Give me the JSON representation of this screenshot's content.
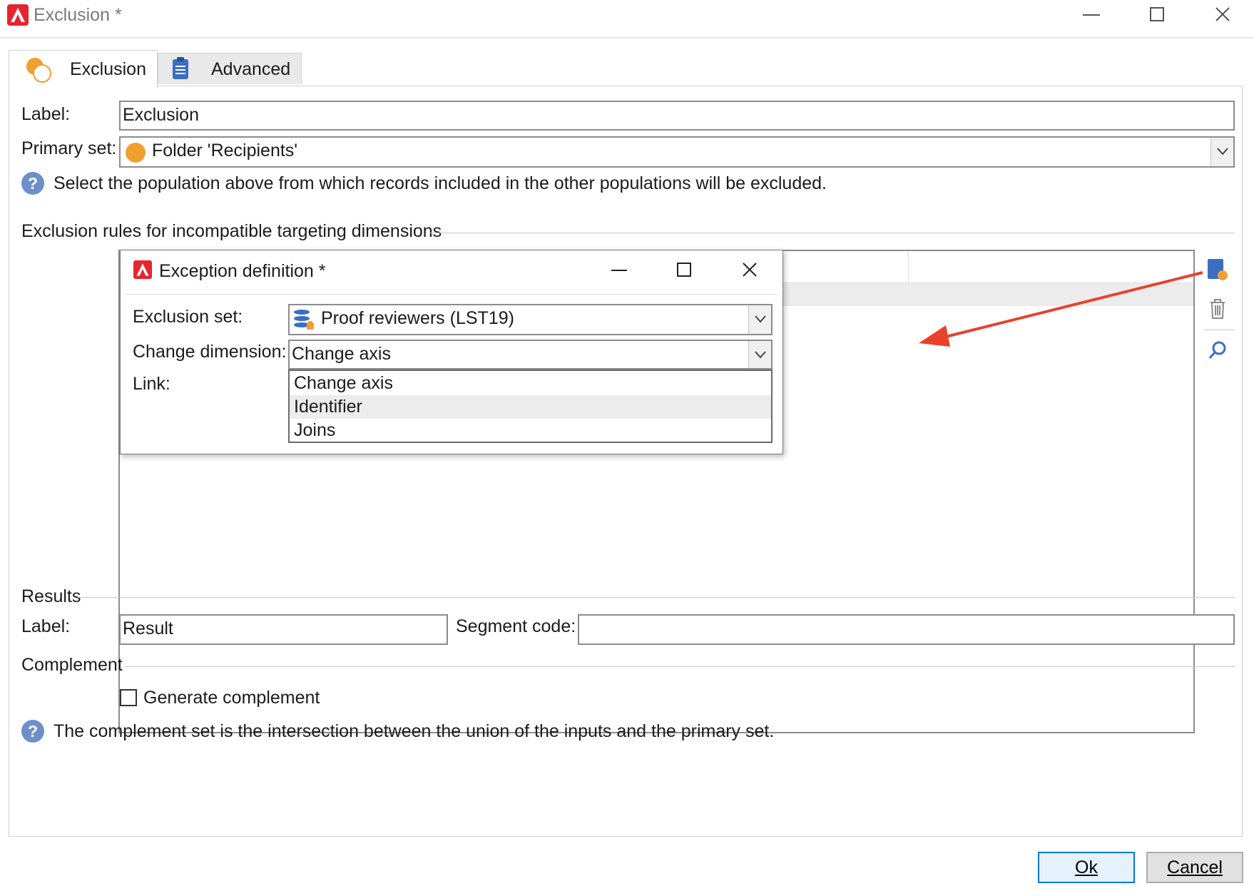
{
  "window": {
    "title": "Exclusion *"
  },
  "tabs": [
    {
      "label": "Exclusion",
      "icon": "exclusion-icon",
      "active": true
    },
    {
      "label": "Advanced",
      "icon": "clipboard-icon",
      "active": false
    }
  ],
  "form": {
    "label_label": "Label:",
    "label_value": "Exclusion",
    "primary_set_label": "Primary set:",
    "primary_set_value": "Folder 'Recipients'",
    "primary_set_help": "Select the population above from which records included in the other populations will be excluded."
  },
  "exclusion_rules": {
    "title": "Exclusion rules for incompatible targeting dimensions"
  },
  "dialog": {
    "title": "Exception definition *",
    "exclusion_set_label": "Exclusion set:",
    "exclusion_set_value": "Proof reviewers (LST19)",
    "change_dimension_label": "Change dimension:",
    "change_dimension_value": "Change axis",
    "link_label": "Link:",
    "dropdown_options": [
      "Change axis",
      "Identifier",
      "Joins"
    ],
    "highlighted_option": "Identifier"
  },
  "results": {
    "title": "Results",
    "label_label": "Label:",
    "label_value": "Result",
    "segment_code_label": "Segment code:",
    "segment_code_value": ""
  },
  "complement": {
    "title": "Complement",
    "checkbox_label": "Generate complement",
    "checked": false,
    "help": "The complement set is the intersection between the union of the inputs and the primary set."
  },
  "buttons": {
    "ok": "Ok",
    "cancel": "Cancel"
  },
  "colors": {
    "accent": "#0078d7",
    "annotation_arrow": "#e8412c",
    "brand": "#e8242e",
    "primary_set_dot": "#f0a030"
  }
}
